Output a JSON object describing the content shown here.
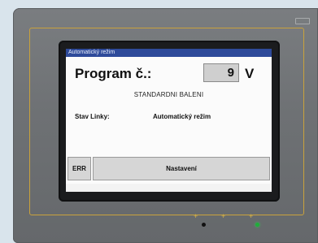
{
  "screen": {
    "title": "Automatický režim",
    "program_label": "Program č.:",
    "program_value": "9",
    "program_unit": "V",
    "subtitle": "STANDARDNI BALENI",
    "line_status_label": "Stav Linky:",
    "line_status_value": "Automatický režim",
    "buttons": {
      "err": "ERR",
      "settings": "Nastavení"
    }
  },
  "device": {
    "keys": [
      "+",
      "+",
      "+"
    ],
    "indicator_colors": {
      "frame": "#c9a23c",
      "titlebar": "#2e4a9a",
      "led_on": "#1fae3a"
    }
  }
}
